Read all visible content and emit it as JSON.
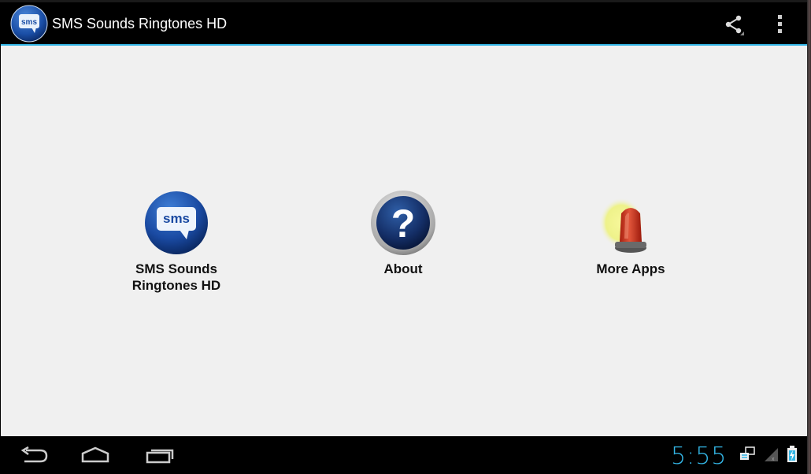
{
  "app": {
    "title": "SMS Sounds Ringtones HD",
    "icon_name": "sms-bubble-icon",
    "icon_text": "sms"
  },
  "action_bar": {
    "share_icon": "share-icon",
    "overflow_icon": "overflow-menu-icon",
    "accent_color": "#33b5e5"
  },
  "launcher": {
    "items": [
      {
        "label_line1": "SMS Sounds",
        "label_line2": "Ringtones HD",
        "icon": "sms-bubble-icon",
        "icon_text": "sms"
      },
      {
        "label": "About",
        "icon": "question-mark-icon"
      },
      {
        "label": "More Apps",
        "icon": "red-siren-icon"
      }
    ]
  },
  "system_bar": {
    "time": "5:55",
    "nav": [
      "back-icon",
      "home-icon",
      "recent-apps-icon"
    ],
    "status_icons": [
      "notification-icon",
      "signal-icon",
      "battery-charging-icon"
    ]
  }
}
